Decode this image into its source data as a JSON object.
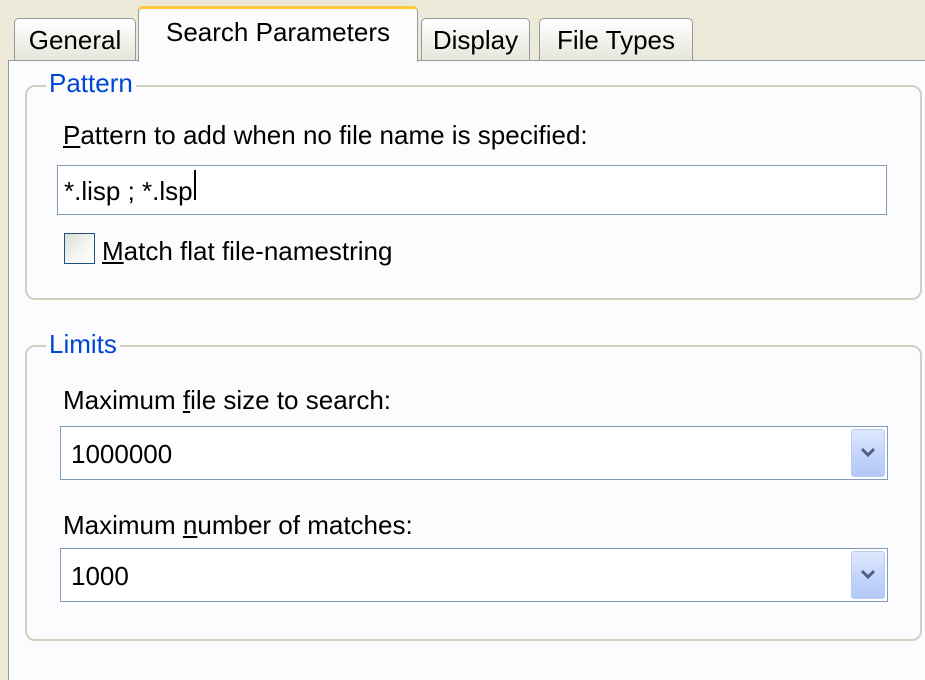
{
  "tabs": {
    "general": "General",
    "search_parameters": "Search Parameters",
    "display": "Display",
    "file_types": "File Types"
  },
  "pattern_group": {
    "title": "Pattern",
    "label_mnemonic": "P",
    "label_rest": "attern to add when no file name is specified:",
    "value": "*.lisp ; *.lsp",
    "checkbox_mnemonic": "M",
    "checkbox_rest": "atch flat file-namestring",
    "checkbox_checked": false
  },
  "limits_group": {
    "title": "Limits",
    "max_size_label_before": "Maximum ",
    "max_size_label_mnemonic": "f",
    "max_size_label_after": "ile size to search:",
    "max_size_value": "1000000",
    "max_matches_label_before": "Maximum ",
    "max_matches_label_mnemonic": "n",
    "max_matches_label_after": "umber of matches:",
    "max_matches_value": "1000"
  },
  "icons": {
    "dropdown": "chevron-down-icon"
  },
  "colors": {
    "group_title": "#0046d5",
    "selected_tab_accent": "#ffc83c",
    "dropdown_arrow": "#4d6185"
  }
}
